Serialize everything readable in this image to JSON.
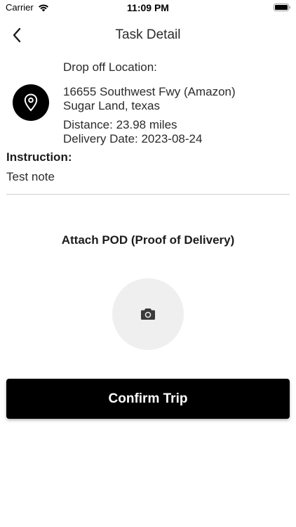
{
  "status_bar": {
    "carrier": "Carrier",
    "time": "11:09 PM",
    "icons": [
      "wifi-icon",
      "battery-icon"
    ]
  },
  "nav": {
    "title": "Task Detail",
    "back_icon": "chevron-left-icon"
  },
  "dropoff": {
    "label": "Drop off Location:",
    "icon": "location-pin-icon",
    "address_line1": "16655 Southwest Fwy (Amazon)",
    "address_line2": "Sugar Land, texas",
    "distance": "Distance: 23.98 miles",
    "delivery_date": "Delivery Date: 2023-08-24"
  },
  "instruction": {
    "label": "Instruction:",
    "text": "Test note"
  },
  "pod": {
    "title": "Attach POD (Proof of Delivery)",
    "icon": "camera-icon"
  },
  "actions": {
    "confirm_label": "Confirm Trip"
  }
}
